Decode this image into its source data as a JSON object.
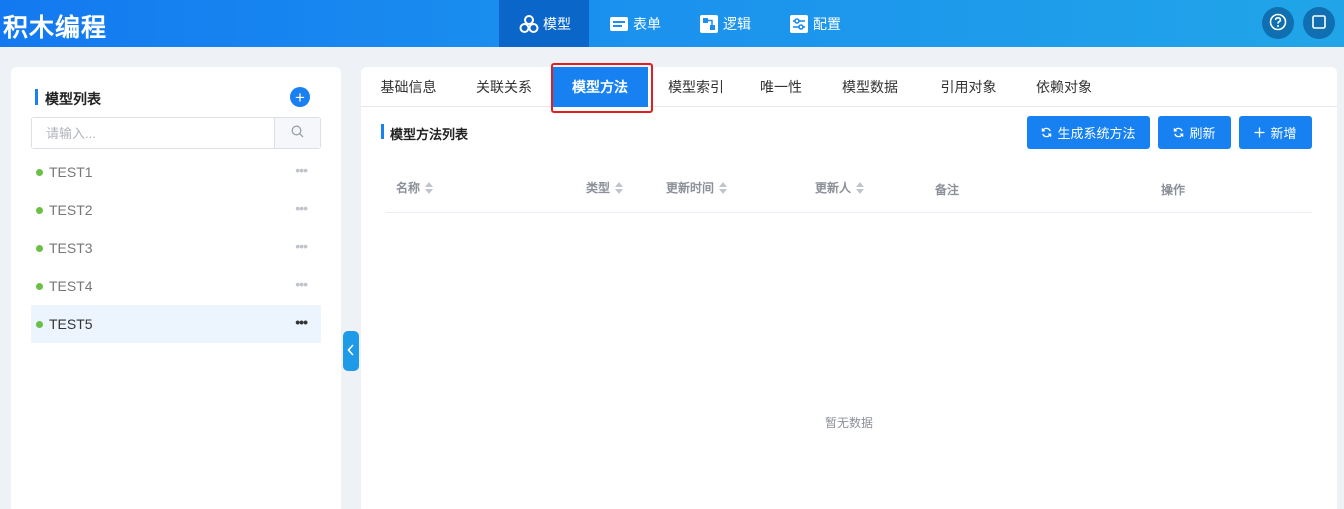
{
  "app": {
    "title": "积木编程"
  },
  "nav": {
    "items": [
      {
        "label": "模型",
        "icon": "cubes-icon",
        "active": true
      },
      {
        "label": "表单",
        "icon": "form-icon",
        "active": false
      },
      {
        "label": "逻辑",
        "icon": "logic-icon",
        "active": false
      },
      {
        "label": "配置",
        "icon": "config-icon",
        "active": false
      }
    ],
    "right_icons": [
      "help-icon",
      "window-icon"
    ]
  },
  "sidebar": {
    "title": "模型列表",
    "search_placeholder": "请输入...",
    "items": [
      {
        "name": "TEST1",
        "selected": false
      },
      {
        "name": "TEST2",
        "selected": false
      },
      {
        "name": "TEST3",
        "selected": false
      },
      {
        "name": "TEST4",
        "selected": false
      },
      {
        "name": "TEST5",
        "selected": true
      }
    ]
  },
  "main": {
    "tabs": [
      {
        "label": "基础信息"
      },
      {
        "label": "关联关系"
      },
      {
        "label": "模型方法",
        "active": true
      },
      {
        "label": "模型索引"
      },
      {
        "label": "唯一性"
      },
      {
        "label": "模型数据"
      },
      {
        "label": "引用对象"
      },
      {
        "label": "依赖对象"
      }
    ],
    "section_title": "模型方法列表",
    "buttons": {
      "generate": "生成系统方法",
      "refresh": "刷新",
      "add": "新增"
    },
    "columns": [
      {
        "label": "名称",
        "sortable": true
      },
      {
        "label": "类型",
        "sortable": true
      },
      {
        "label": "更新时间",
        "sortable": true
      },
      {
        "label": "更新人",
        "sortable": true
      },
      {
        "label": "备注",
        "sortable": false
      },
      {
        "label": "操作",
        "sortable": false
      }
    ],
    "empty_text": "暂无数据"
  },
  "colors": {
    "primary": "#1781f1",
    "highlight": "#e02020",
    "status_dot": "#6cbf45"
  }
}
